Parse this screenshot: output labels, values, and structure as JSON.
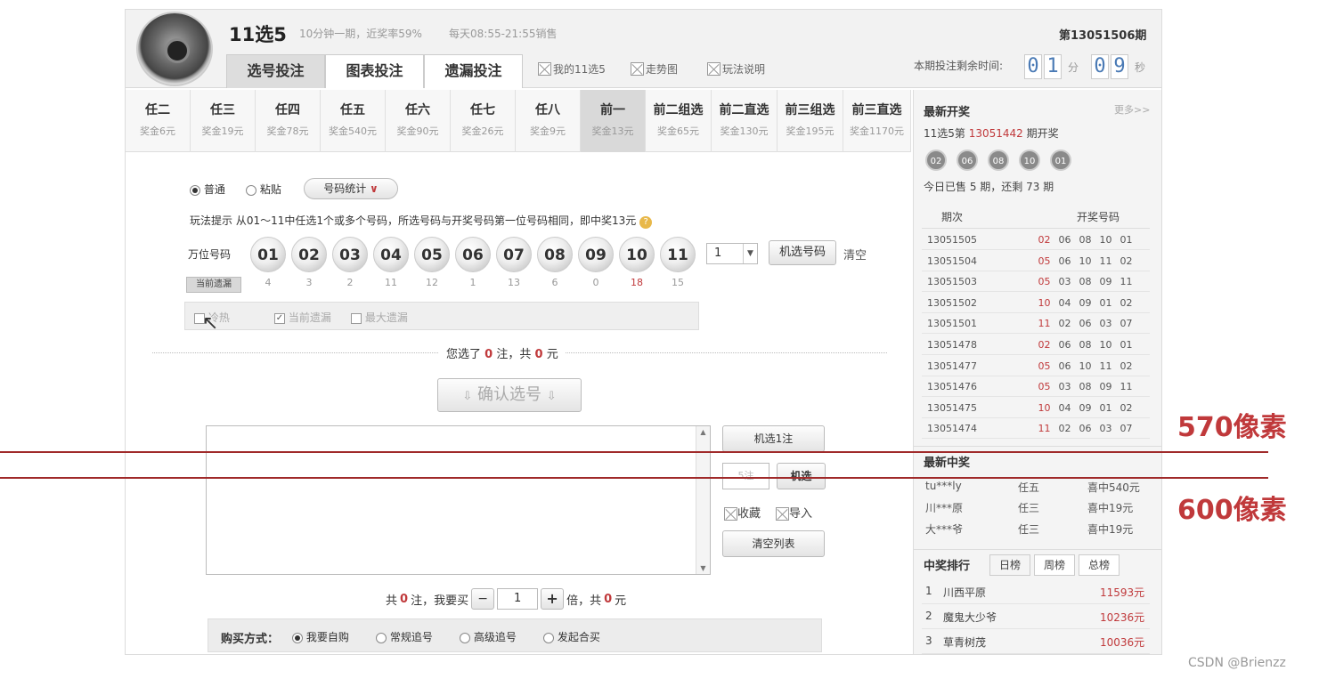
{
  "header": {
    "title": "11选5",
    "subtitle1": "10分钟一期，近奖率59%",
    "subtitle2": "每天08:55-21:55销售",
    "issue": "第13051506期"
  },
  "main_tabs": [
    {
      "label": "选号投注"
    },
    {
      "label": "图表投注"
    },
    {
      "label": "遗漏投注"
    }
  ],
  "links": [
    {
      "label": "我的11选5"
    },
    {
      "label": "走势图"
    },
    {
      "label": "玩法说明"
    }
  ],
  "countdown": {
    "label": "本期投注剩余时间:",
    "min": [
      "0",
      "1"
    ],
    "min_unit": "分",
    "sec": [
      "0",
      "9"
    ],
    "sec_unit": "秒"
  },
  "play_tabs": [
    {
      "name": "任二",
      "prize": "奖金6元"
    },
    {
      "name": "任三",
      "prize": "奖金19元"
    },
    {
      "name": "任四",
      "prize": "奖金78元"
    },
    {
      "name": "任五",
      "prize": "奖金540元"
    },
    {
      "name": "任六",
      "prize": "奖金90元"
    },
    {
      "name": "任七",
      "prize": "奖金26元"
    },
    {
      "name": "任八",
      "prize": "奖金9元"
    },
    {
      "name": "前一",
      "prize": "奖金13元"
    },
    {
      "name": "前二组选",
      "prize": "奖金65元"
    },
    {
      "name": "前二直选",
      "prize": "奖金130元"
    },
    {
      "name": "前三组选",
      "prize": "奖金195元"
    },
    {
      "name": "前三直选",
      "prize": "奖金1170元"
    }
  ],
  "mode": {
    "normal": "普通",
    "paste": "粘贴",
    "stats": "号码统计"
  },
  "tip": "玩法提示  从01～11中任选1个或多个号码，所选号码与开奖号码第一位号码相同，即中奖13元",
  "row_label": "万位号码",
  "balls": [
    "01",
    "02",
    "03",
    "04",
    "05",
    "06",
    "07",
    "08",
    "09",
    "10",
    "11"
  ],
  "miss_label": "当前遗漏",
  "miss": [
    "4",
    "3",
    "2",
    "11",
    "12",
    "1",
    "13",
    "6",
    "0",
    "18",
    "15"
  ],
  "qty": "1",
  "random_btn": "机选号码",
  "clear": "清空",
  "filters": [
    {
      "label": "冷热",
      "checked": false
    },
    {
      "label": "当前遗漏",
      "checked": true
    },
    {
      "label": "最大遗漏",
      "checked": false
    }
  ],
  "selected_pre": "您选了",
  "selected_count": "0",
  "selected_mid": "注，共",
  "selected_amount": "0",
  "selected_unit": "元",
  "confirm": "确认选号",
  "side_btns": {
    "rand1": "机选1注",
    "count_placeholder": "5注",
    "rand": "机选",
    "fav": "收藏",
    "import": "导入",
    "clear_list": "清空列表"
  },
  "bet": {
    "pre": "共",
    "count": "0",
    "mid": "注，我要买",
    "times": "1",
    "unit": "倍，共",
    "amount": "0",
    "yuan": "元"
  },
  "buy": {
    "label": "购买方式：",
    "opts": [
      "我要自购",
      "常规追号",
      "高级追号",
      "发起合买"
    ]
  },
  "latest": {
    "title": "最新开奖",
    "more": "更多>>",
    "line_pre": "11选5第",
    "line_issue": "13051442",
    "line_post": "期开奖",
    "balls": [
      "02",
      "06",
      "08",
      "10",
      "01"
    ],
    "sold": "今日已售 5 期，还剩 73 期"
  },
  "draw_table": {
    "headers": [
      "期次",
      "开奖号码"
    ],
    "rows": [
      {
        "issue": "13051505",
        "nums": [
          "02",
          "06",
          "08",
          "10",
          "01"
        ]
      },
      {
        "issue": "13051504",
        "nums": [
          "05",
          "06",
          "10",
          "11",
          "02"
        ]
      },
      {
        "issue": "13051503",
        "nums": [
          "05",
          "03",
          "08",
          "09",
          "11"
        ]
      },
      {
        "issue": "13051502",
        "nums": [
          "10",
          "04",
          "09",
          "01",
          "02"
        ]
      },
      {
        "issue": "13051501",
        "nums": [
          "11",
          "02",
          "06",
          "03",
          "07"
        ]
      },
      {
        "issue": "13051478",
        "nums": [
          "02",
          "06",
          "08",
          "10",
          "01"
        ]
      },
      {
        "issue": "13051477",
        "nums": [
          "05",
          "06",
          "10",
          "11",
          "02"
        ]
      },
      {
        "issue": "13051476",
        "nums": [
          "05",
          "03",
          "08",
          "09",
          "11"
        ]
      },
      {
        "issue": "13051475",
        "nums": [
          "10",
          "04",
          "09",
          "01",
          "02"
        ]
      },
      {
        "issue": "13051474",
        "nums": [
          "11",
          "02",
          "06",
          "03",
          "07"
        ]
      }
    ]
  },
  "winners": {
    "title": "最新中奖",
    "rows": [
      {
        "user": "tu***ly",
        "play": "任五",
        "prize": "喜中540元"
      },
      {
        "user": "川***原",
        "play": "任三",
        "prize": "喜中19元"
      },
      {
        "user": "大***爷",
        "play": "任三",
        "prize": "喜中19元"
      }
    ]
  },
  "ranking": {
    "title": "中奖排行",
    "tabs": [
      "日榜",
      "周榜",
      "总榜"
    ],
    "rows": [
      {
        "rank": "1",
        "name": "川西平原",
        "amount": "11593元"
      },
      {
        "rank": "2",
        "name": "魔鬼大少爷",
        "amount": "10236元"
      },
      {
        "rank": "3",
        "name": "草青树茂",
        "amount": "10036元"
      }
    ]
  },
  "annotations": {
    "a570": "570像素",
    "a600": "600像素"
  },
  "watermark": "CSDN @Brienzz",
  "colors": {
    "accent_red": "#c0393b",
    "digit_blue": "#4a7ab5"
  }
}
